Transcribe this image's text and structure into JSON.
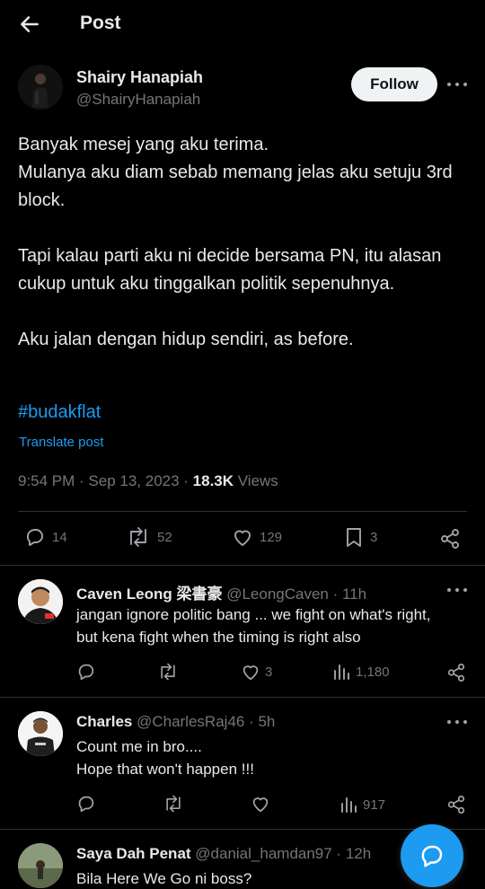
{
  "header": {
    "title": "Post",
    "back_icon": "arrow-left-icon"
  },
  "post": {
    "author_name": "Shairy Hanapiah",
    "author_handle": "@ShairyHanapiah",
    "follow_label": "Follow",
    "lines": [
      "Banyak mesej yang aku terima.",
      "Mulanya aku diam sebab memang jelas aku setuju 3rd block.",
      "Tapi kalau parti aku ni decide bersama PN, itu alasan cukup untuk aku tinggalkan politik sepenuhnya.",
      "Aku jalan dengan hidup sendiri, as before."
    ],
    "hashtag": "#budakflat",
    "translate_label": "Translate post",
    "timestamp": "9:54 PM · Sep 13, 2023 · ",
    "views_count": "18.3K",
    "views_label": " Views",
    "stats": {
      "replies": "14",
      "reposts": "52",
      "likes": "129",
      "bookmarks": "3"
    }
  },
  "replies": [
    {
      "name": "Caven Leong 梁書豪",
      "handle": " @LeongCaven · 11h",
      "text": "jangan ignore politic bang ... we fight on what's right, but kena fight when the timing is right also",
      "likes": "3",
      "views": "1,180"
    },
    {
      "name": "Charles",
      "handle": " @CharlesRaj46 · 5h",
      "text_lines": [
        "Count me in bro....",
        "Hope that won't happen  !!!"
      ],
      "likes": "",
      "views": "917"
    },
    {
      "name": "Saya Dah Penat",
      "handle": " @danial_hamdan97 · 12h",
      "text": "Bila Here We Go ni boss?"
    }
  ],
  "colors": {
    "background": "#000000",
    "accent": "#1d9bf0",
    "text": "#e7e9ea",
    "muted": "#71767b"
  }
}
